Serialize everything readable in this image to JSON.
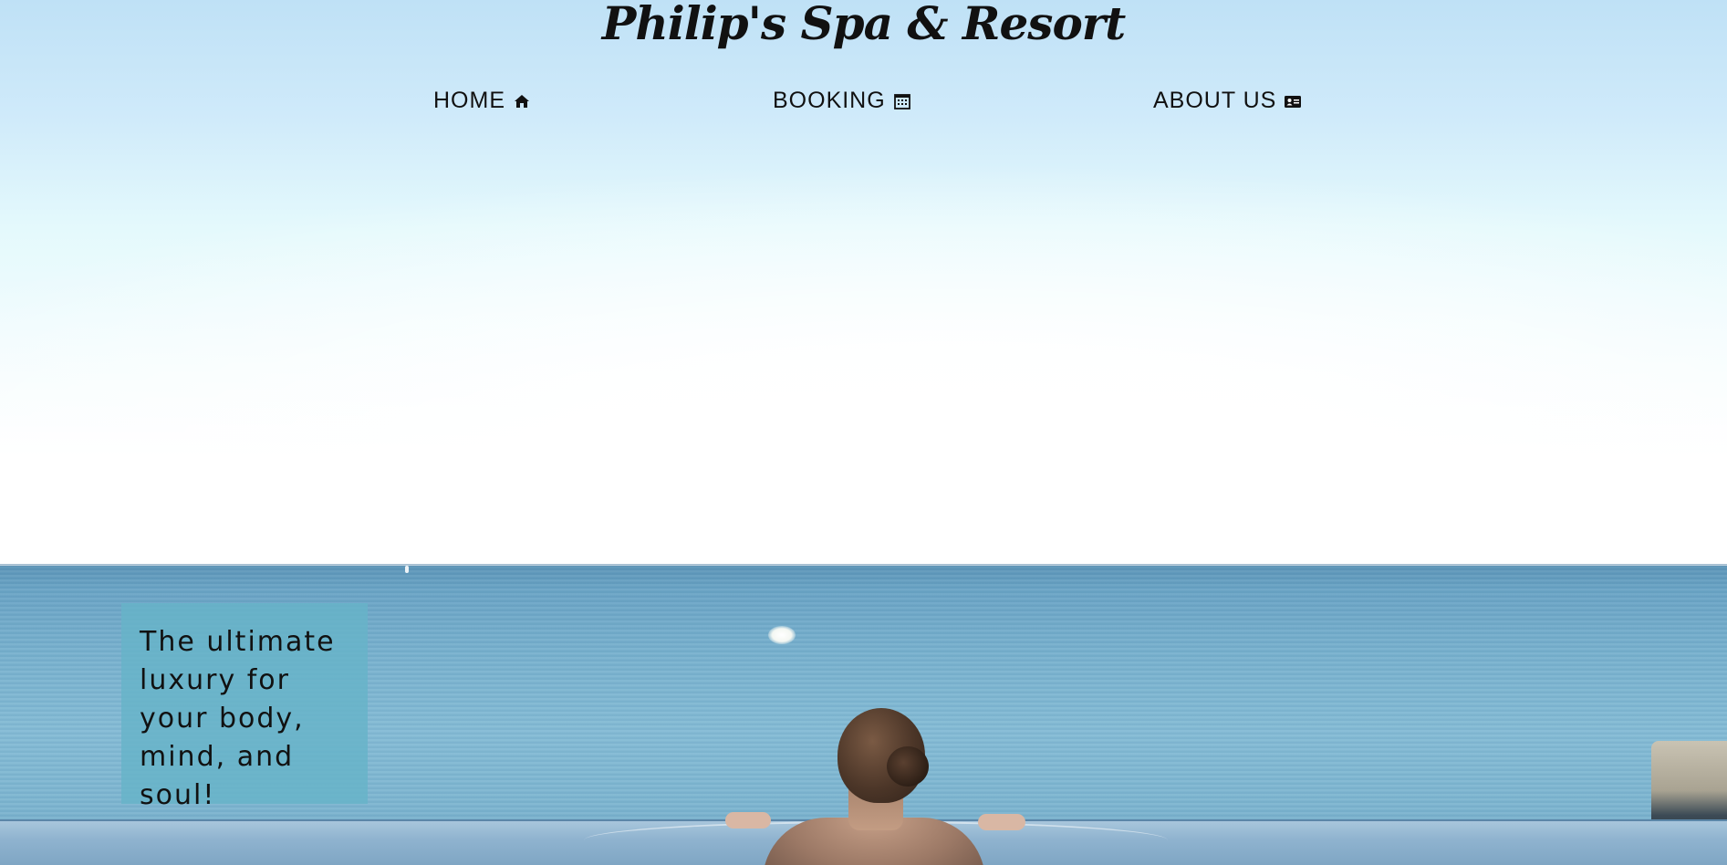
{
  "header": {
    "title": "Philip's Spa & Resort"
  },
  "nav": {
    "items": [
      {
        "label": "HOME",
        "icon": "home-icon"
      },
      {
        "label": "BOOKING",
        "icon": "calendar-icon"
      },
      {
        "label": "ABOUT US",
        "icon": "id-card-icon"
      }
    ]
  },
  "hero": {
    "tagline": "The ultimate luxury for your body, mind, and soul!",
    "tagline_box_color": "#66b3c8"
  },
  "colors": {
    "text": "#111111",
    "sky": "#cfeafa",
    "sea": "#78b1ce"
  }
}
